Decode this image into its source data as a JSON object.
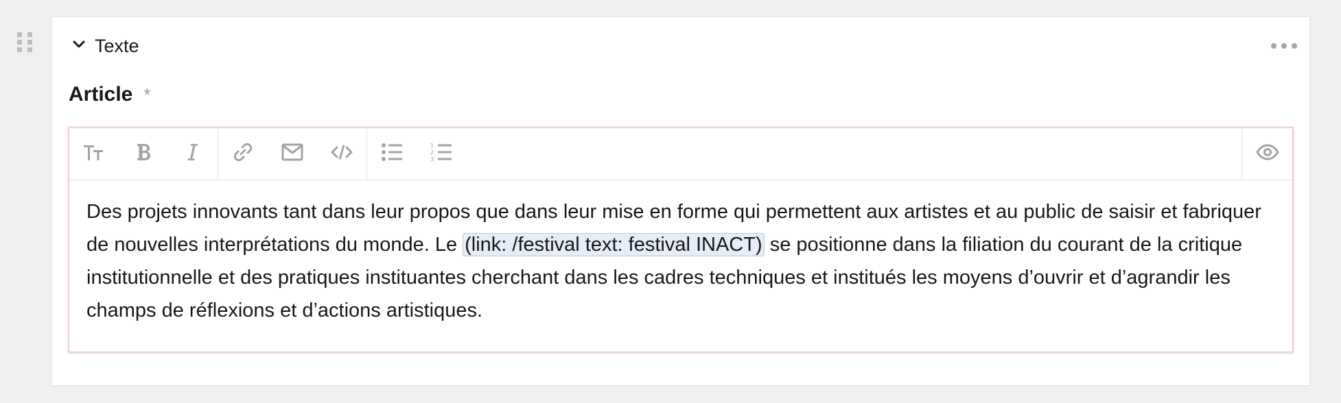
{
  "block": {
    "title": "Texte"
  },
  "field": {
    "label": "Article",
    "required_mark": "*"
  },
  "toolbar": {
    "groups": [
      [
        "headings-icon",
        "bold-icon",
        "italic-icon"
      ],
      [
        "link-icon",
        "email-icon",
        "code-icon"
      ],
      [
        "bullet-list-icon",
        "ordered-list-icon"
      ]
    ],
    "preview": "eye-icon"
  },
  "editor": {
    "text_before": "Des projets innovants tant dans leur propos que dans leur mise en forme qui permettent aux artistes et au public de saisir et fabriquer de nouvelles interprétations du monde. Le ",
    "kirbytag": "(link: /festival text: festival INACT)",
    "text_after": " se positionne dans la filiation du courant de la critique institutionnelle et des pratiques instituantes cherchant dans les cadres techniques et institués les moyens d’ouvrir et d’agrandir les champs de réflexions et d’actions artistiques."
  },
  "colors": {
    "background": "#efefef",
    "panel": "#ffffff",
    "icon": "#a3a3a3",
    "tag_highlight": "#e7edf7",
    "editor_border": "#e8c5c5"
  }
}
